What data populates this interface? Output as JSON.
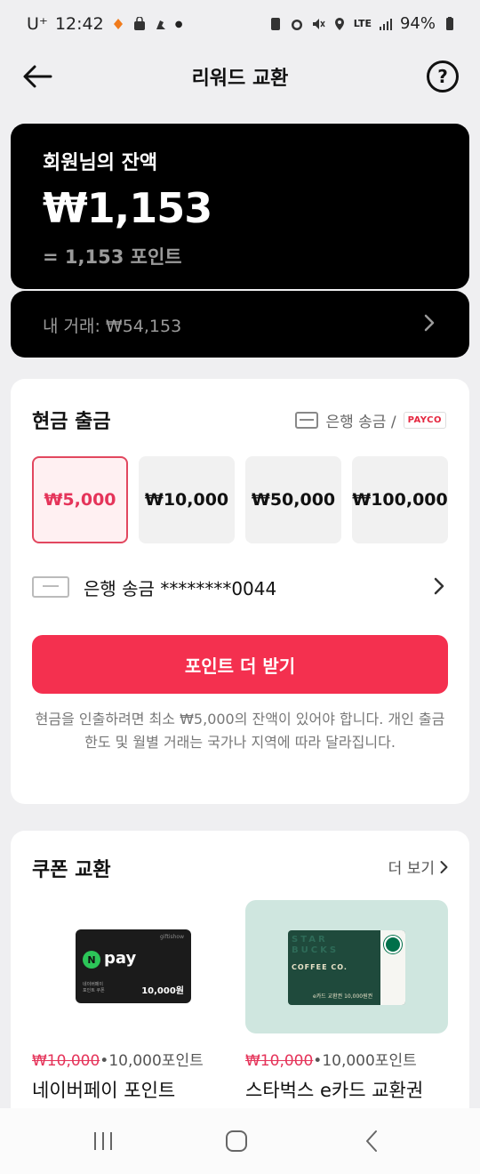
{
  "status_bar": {
    "carrier": "U⁺",
    "time": "12:42",
    "network": "LTE",
    "battery": "94%"
  },
  "app_bar": {
    "title": "리워드 교환",
    "back_icon": "arrow-left-icon",
    "help_icon": "question-circle-icon"
  },
  "balance": {
    "label": "회원님의 잔액",
    "amount": "₩1,153",
    "points": "= 1,153 포인트",
    "trades": "내 거래: ₩54,153"
  },
  "cash_out": {
    "title": "현금 출금",
    "method_label": "은행 송금 /",
    "method_brand": "PAYCO",
    "amounts": [
      "₩5,000",
      "₩10,000",
      "₩50,000",
      "₩100,000"
    ],
    "selected_index": 0,
    "bank_account": "은행 송금 ********0044",
    "cta": "포인트 더 받기",
    "note": "현금을 인출하려면 최소 ₩5,000의 잔액이 있어야 합니다. 개인 출금 한도 및 월별 거래는 국가나 지역에 따라 달라집니다."
  },
  "coupons": {
    "title": "쿠폰 교환",
    "more": "더 보기",
    "items": [
      {
        "name": "네이버페이 포인트",
        "original_price": "₩10,000",
        "points_price": "•10,000포인트",
        "image": {
          "brand": "giftishow",
          "logo_letter": "N",
          "logo_text": "pay",
          "sub": "네이버페이\n포인트 쿠폰",
          "value": "10,000원"
        }
      },
      {
        "name": "스타벅스 e카드 교환권",
        "original_price": "₩10,000",
        "points_price": "•10,000포인트",
        "image": {
          "line1": "STAR",
          "line2": "BUCKS",
          "line3": "COFFEE CO.",
          "value": "e카드 교환권 10,000원권"
        }
      }
    ]
  },
  "colors": {
    "accent": "#f4304f",
    "selected_text": "#e5345a",
    "dark_card": "#000000",
    "background": "#efeff1"
  }
}
